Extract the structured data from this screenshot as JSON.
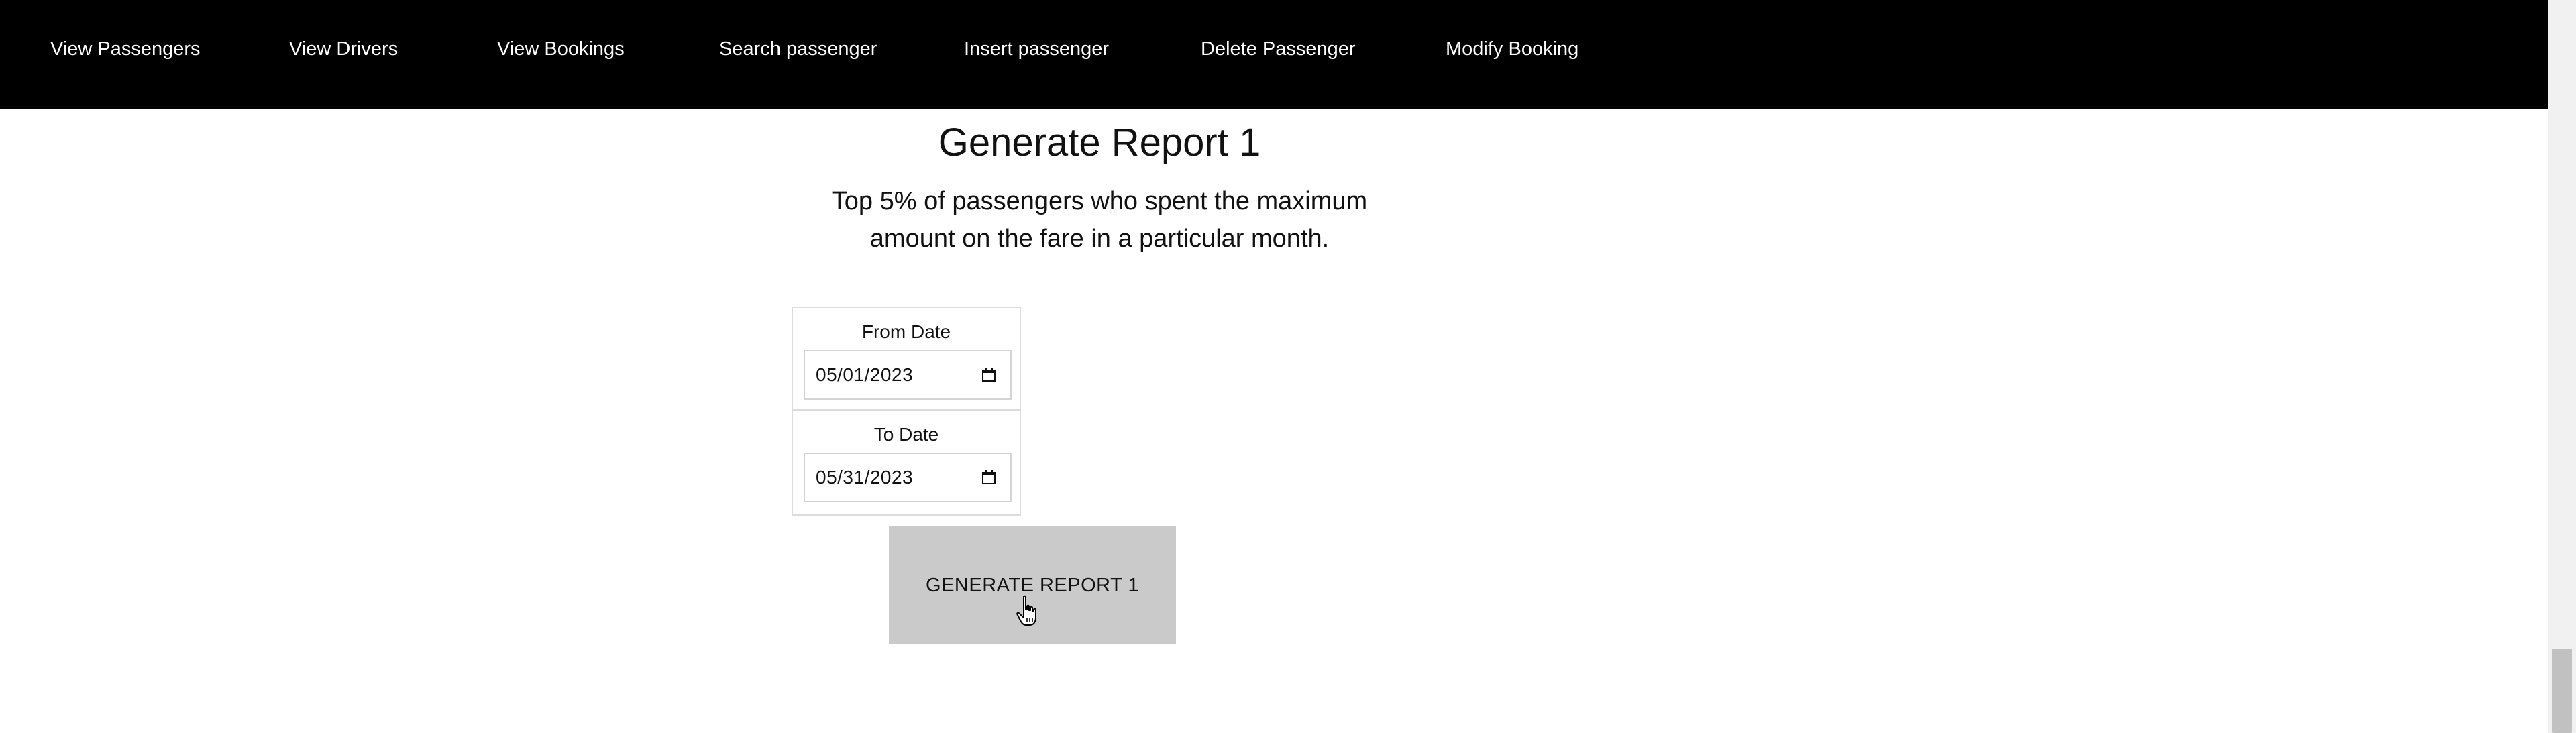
{
  "nav": {
    "items": [
      {
        "label": "View Passengers"
      },
      {
        "label": "View Drivers"
      },
      {
        "label": "View Bookings"
      },
      {
        "label": "Search passenger"
      },
      {
        "label": "Insert passenger"
      },
      {
        "label": "Delete Passenger"
      },
      {
        "label": "Modify Booking"
      }
    ]
  },
  "report": {
    "title": "Generate Report 1",
    "description": "Top 5% of passengers who spent the maximum amount on the fare in a particular month.",
    "from": {
      "label": "From Date",
      "value": "05/01/2023"
    },
    "to": {
      "label": "To Date",
      "value": "05/31/2023"
    },
    "button_label": "GENERATE REPORT 1"
  },
  "icons": {
    "calendar": "calendar-icon",
    "cursor": "hand-pointer-icon"
  },
  "colors": {
    "navbar_bg": "#000000",
    "nav_text": "#ffffff",
    "button_bg": "#cacaca"
  }
}
